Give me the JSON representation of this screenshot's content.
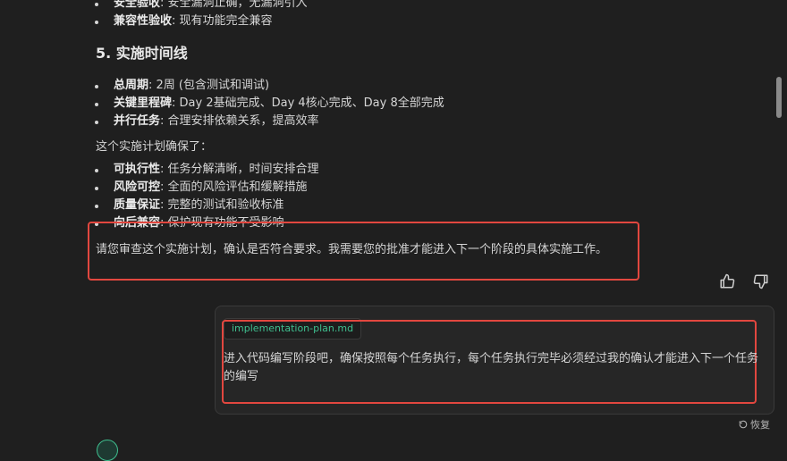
{
  "top_items": [
    {
      "bold": "安全验收",
      "text": ": 安全漏洞止确，无漏洞引入"
    },
    {
      "bold": "兼容性验收",
      "text": ": 现有功能完全兼容"
    }
  ],
  "section5": {
    "title": "5. 实施时间线",
    "items": [
      {
        "bold": "总周期",
        "text": ": 2周 (包含测试和调试)"
      },
      {
        "bold": "关键里程碑",
        "text": ": Day 2基础完成、Day 4核心完成、Day 8全部完成"
      },
      {
        "bold": "并行任务",
        "text": ": 合理安排依赖关系，提高效率"
      }
    ]
  },
  "intro": "这个实施计划确保了：",
  "benefits": [
    {
      "bold": "可执行性",
      "text": ": 任务分解清晰，时间安排合理"
    },
    {
      "bold": "风险可控",
      "text": ": 全面的风险评估和缓解措施"
    },
    {
      "bold": "质量保证",
      "text": ": 完整的测试和验收标准"
    },
    {
      "bold": "向后兼容",
      "text": ": 保护现有功能不受影响"
    }
  ],
  "review_request": "请您审查这个实施计划，确认是否符合要求。我需要您的批准才能进入下一个阶段的具体实施工作。",
  "feedback": {
    "like_icon": "thumbs-up-icon",
    "dislike_icon": "thumbs-down-icon"
  },
  "user_message": {
    "attachment": "implementation-plan.md",
    "line1": "进入代码编写阶段吧，确保按照每个任务执行，每个任务执行完毕必须经过我的确认才能进入下一个任务",
    "line2": "的编写"
  },
  "restore_label": "恢复",
  "colors": {
    "highlight_box": "#e2473f",
    "attachment_text": "#3fbf8f",
    "background": "#1f1f1f"
  }
}
